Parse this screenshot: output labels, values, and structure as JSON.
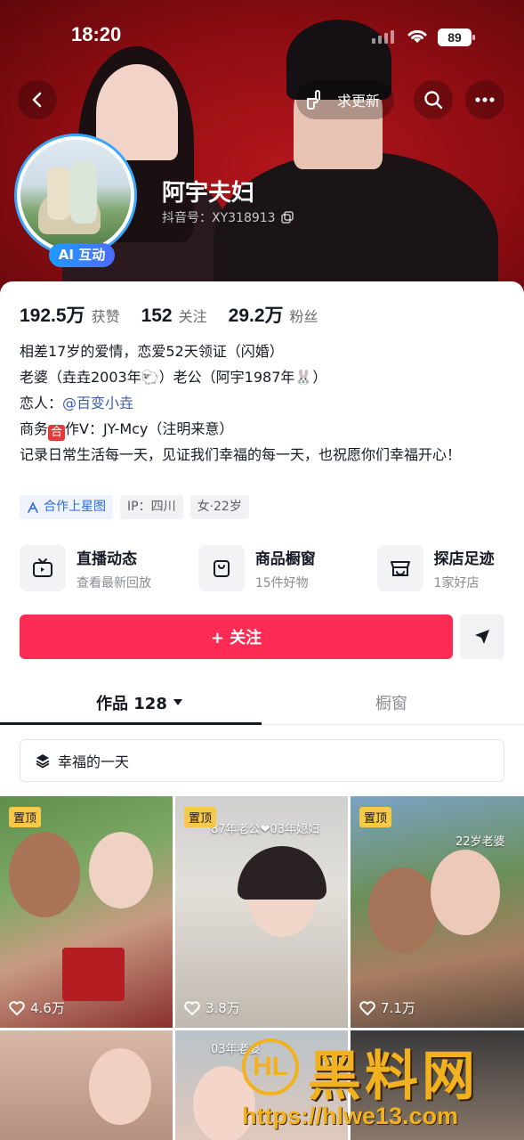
{
  "status_bar": {
    "time": "18:20",
    "battery": "89"
  },
  "header": {
    "update_label": "求更新",
    "nickname": "阿宇夫妇",
    "douyin_id": "抖音号：XY318913",
    "ai_badge": "AI 互动"
  },
  "stats": [
    {
      "value": "192.5万",
      "label": "获赞"
    },
    {
      "value": "152",
      "label": "关注"
    },
    {
      "value": "29.2万",
      "label": "粉丝"
    }
  ],
  "bio": {
    "line1": "相差17岁的爱情，恋爱52天领证（闪婚）",
    "line2_pre": "老婆（垚垚2003年",
    "line2_emoji1": "🐑",
    "line2_mid": "）老公（阿宇1987年",
    "line2_emoji2": "🐰",
    "line2_post": "）",
    "line3_pre": "恋人：",
    "line3_mention": "@百变小垚",
    "line4_pre": "商务",
    "line4_box": "合",
    "line4_post": "作V：JY-Mcy（注明来意）",
    "line5": "记录日常生活每一天，见证我们幸福的每一天，也祝愿你们幸福开心！"
  },
  "tags": [
    "合作上星图",
    "IP：四川",
    "女·22岁"
  ],
  "features": [
    {
      "title": "直播动态",
      "subtitle": "查看最新回放",
      "icon": "tv-icon"
    },
    {
      "title": "商品橱窗",
      "subtitle": "15件好物",
      "icon": "shopping-bag-icon"
    },
    {
      "title": "探店足迹",
      "subtitle": "1家好店",
      "icon": "store-icon"
    }
  ],
  "actions": {
    "follow_label": "+ 关注"
  },
  "tabs": {
    "works": "作品 128",
    "window": "橱窗"
  },
  "collection": {
    "label": "幸福的一天"
  },
  "videos": [
    {
      "pinned": "置顶",
      "likes": "4.6万",
      "caption": ""
    },
    {
      "pinned": "置顶",
      "likes": "3.8万",
      "caption": "87年老公❤03年媳妇"
    },
    {
      "pinned": "置顶",
      "likes": "7.1万",
      "caption": "22岁老婆"
    },
    {
      "pinned": "",
      "likes": "",
      "caption": ""
    },
    {
      "pinned": "",
      "likes": "",
      "caption": "03年老婆"
    },
    {
      "pinned": "",
      "likes": "",
      "caption": ""
    }
  ],
  "watermark": {
    "title": "黑料网",
    "url": "https://hlwe13.com",
    "logo": "HL"
  },
  "colors": {
    "accent": "#fe2c55",
    "banner": "#8e0d12",
    "ai_badge": "#1e9bff",
    "watermark": "#f2b21f"
  }
}
